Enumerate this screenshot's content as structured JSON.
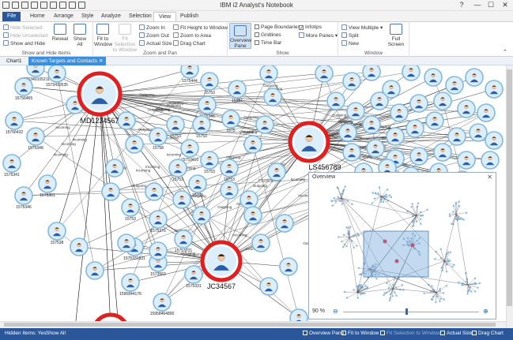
{
  "titlebar": {
    "title": "IBM i2 Analyst's Notebook",
    "help": "?",
    "minimize": "—",
    "maximize": "☐",
    "close": "✕"
  },
  "ribbon_tabs": [
    "File",
    "Home",
    "Arrange",
    "Style",
    "Analyze",
    "Selection",
    "View",
    "Publish"
  ],
  "active_tab": "View",
  "ribbon": {
    "show_hide": {
      "hide_selected": "Hide Selected",
      "hide_unselected": "Hide Unselected",
      "show_and_hide": "Show and Hide",
      "reveal": "Reveal",
      "show_all": "Show All",
      "label": "Show and Hide Items"
    },
    "zoom_pan": {
      "fit_to_window": "Fit to Window",
      "fit_selection": "Fit Selection to Window",
      "zoom_in": "Zoom In",
      "zoom_out": "Zoom Out",
      "actual_size": "Actual Size",
      "fit_height": "Fit Height to Window",
      "zoom_to_area": "Zoom to Area",
      "drag_chart": "Drag Chart",
      "label": "Zoom and Pan"
    },
    "show": {
      "overview_pane": "Overview Pane",
      "page_boundaries": "Page Boundaries",
      "gridlines": "Gridlines",
      "time_bar": "Time Bar",
      "infotips": "Infotips",
      "more_panes": "More Panes",
      "label": "Show"
    },
    "window": {
      "view_multiple": "View Multiple",
      "split": "Split",
      "new": "New",
      "full_screen": "Full Screen",
      "label": "Window"
    }
  },
  "doc_tabs": [
    "Chart1",
    "Known Targets and Contacts"
  ],
  "chart": {
    "big_nodes": [
      {
        "label": "MD1234567"
      },
      {
        "label": "LS456789"
      },
      {
        "label": "JC34567"
      }
    ],
    "small_labels": [
      "1575340105211",
      "1573410535",
      "15756465",
      "15756432",
      "1575348",
      "1575341",
      "157538",
      "1575346",
      "1575361",
      "15753",
      "1575376",
      "15753731",
      "1575331",
      "1573562",
      "1575331521",
      "1595844176",
      "15958464800",
      "1575444",
      "15753",
      "15957",
      "1575346",
      "1575",
      "15753",
      "15753",
      "15758",
      "15753410",
      "15753",
      "15753",
      "15753",
      "15753"
    ],
    "edge_labels": [
      "Outgoing",
      "Incoming"
    ]
  },
  "overview": {
    "title": "Overview",
    "close": "✕",
    "zoom_percent": "90 %",
    "zoom_out": "⊖",
    "zoom_in": "⊕"
  },
  "statusbar": {
    "hidden_items": "Hidden Items: Yes",
    "show_all": "Show All",
    "overview_pane": "Overview Pane",
    "fit_to_window": "Fit to Window",
    "fit_selection": "Fit Selection to Window",
    "actual_size": "Actual Size",
    "drag_chart": "Drag Chart"
  }
}
